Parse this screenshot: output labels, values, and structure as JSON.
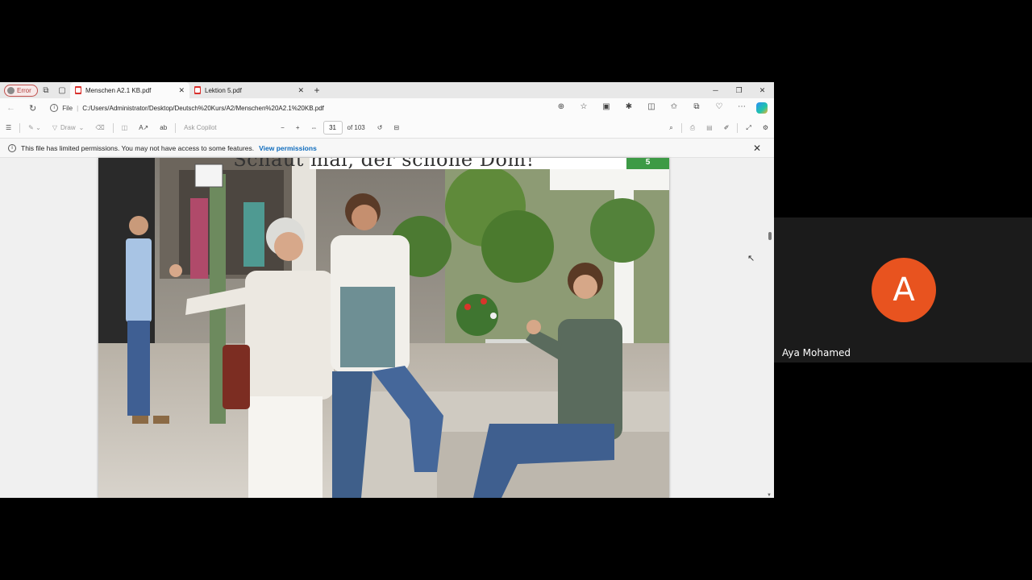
{
  "browser": {
    "profile_label": "Error",
    "tabs": [
      {
        "label": "Menschen A2.1 KB.pdf",
        "active": true
      },
      {
        "label": "Lektion 5.pdf",
        "active": false
      }
    ],
    "address": {
      "scheme_label": "File",
      "url": "C:/Users/Administrator/Desktop/Deutsch%20Kurs/A2/Menschen%20A2.1%20KB.pdf"
    }
  },
  "pdf_toolbar": {
    "draw_label": "Draw",
    "ask_copilot_label": "Ask Copilot",
    "page_number": "31",
    "page_count": "of 103"
  },
  "permissions": {
    "message": "This file has limited permissions. You may not have access to some features.",
    "link_label": "View permissions"
  },
  "document": {
    "heading": "Schaut mal, der schöne Dom!",
    "tag_number": "5"
  },
  "meeting": {
    "participant_initial": "A",
    "participant_name": "Aya Mohamed",
    "avatar_color": "#e8531f"
  }
}
